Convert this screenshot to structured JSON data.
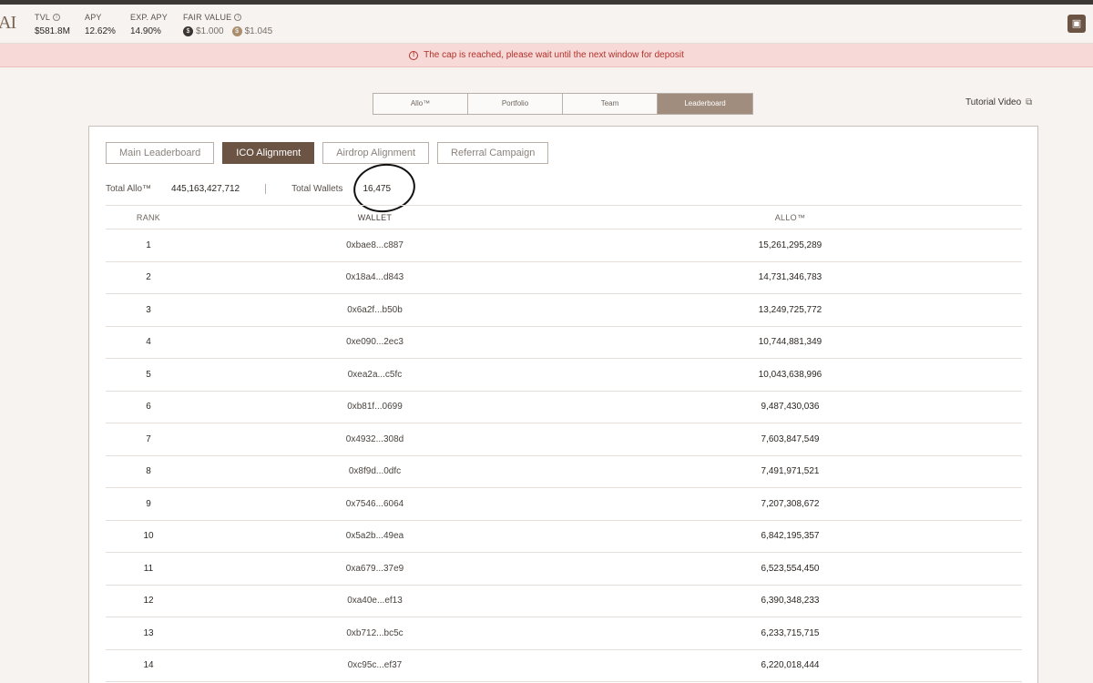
{
  "header": {
    "logo_text": "AI",
    "stats": [
      {
        "label": "TVL",
        "value": "$581.8M",
        "has_info": true
      },
      {
        "label": "APY",
        "value": "12.62%",
        "has_info": false
      },
      {
        "label": "EXP. APY",
        "value": "14.90%",
        "has_info": false
      }
    ],
    "fair_value": {
      "label": "FAIR VALUE",
      "price_a": "$1.000",
      "price_b": "$1.045"
    }
  },
  "banner": {
    "text": "The cap is reached, please wait until the next window for deposit"
  },
  "main_tabs": [
    {
      "label": "Allo™",
      "active": false
    },
    {
      "label": "Portfolio",
      "active": false
    },
    {
      "label": "Team",
      "active": false
    },
    {
      "label": "Leaderboard",
      "active": true
    }
  ],
  "tutorial": {
    "label": "Tutorial Video"
  },
  "sub_tabs": [
    {
      "label": "Main Leaderboard",
      "active": false
    },
    {
      "label": "ICO Alignment",
      "active": true
    },
    {
      "label": "Airdrop Alignment",
      "active": false
    },
    {
      "label": "Referral Campaign",
      "active": false
    }
  ],
  "totals": {
    "allo_label": "Total Allo™",
    "allo_value": "445,163,427,712",
    "wallets_label": "Total Wallets",
    "wallets_value": "16,475"
  },
  "table": {
    "columns": [
      "RANK",
      "WALLET",
      "ALLO™"
    ],
    "rows": [
      {
        "rank": "1",
        "wallet": "0xbae8...c887",
        "allo": "15,261,295,289"
      },
      {
        "rank": "2",
        "wallet": "0x18a4...d843",
        "allo": "14,731,346,783"
      },
      {
        "rank": "3",
        "wallet": "0x6a2f...b50b",
        "allo": "13,249,725,772"
      },
      {
        "rank": "4",
        "wallet": "0xe090...2ec3",
        "allo": "10,744,881,349"
      },
      {
        "rank": "5",
        "wallet": "0xea2a...c5fc",
        "allo": "10,043,638,996"
      },
      {
        "rank": "6",
        "wallet": "0xb81f...0699",
        "allo": "9,487,430,036"
      },
      {
        "rank": "7",
        "wallet": "0x4932...308d",
        "allo": "7,603,847,549"
      },
      {
        "rank": "8",
        "wallet": "0x8f9d...0dfc",
        "allo": "7,491,971,521"
      },
      {
        "rank": "9",
        "wallet": "0x7546...6064",
        "allo": "7,207,308,672"
      },
      {
        "rank": "10",
        "wallet": "0x5a2b...49ea",
        "allo": "6,842,195,357"
      },
      {
        "rank": "11",
        "wallet": "0xa679...37e9",
        "allo": "6,523,554,450"
      },
      {
        "rank": "12",
        "wallet": "0xa40e...ef13",
        "allo": "6,390,348,233"
      },
      {
        "rank": "13",
        "wallet": "0xb712...bc5c",
        "allo": "6,233,715,715"
      },
      {
        "rank": "14",
        "wallet": "0xc95c...ef37",
        "allo": "6,220,018,444"
      }
    ]
  },
  "colors": {
    "accent": "#6b5444",
    "active_tab": "#a08d7d",
    "banner_bg": "#f7d9d7",
    "banner_text": "#b2322b"
  }
}
